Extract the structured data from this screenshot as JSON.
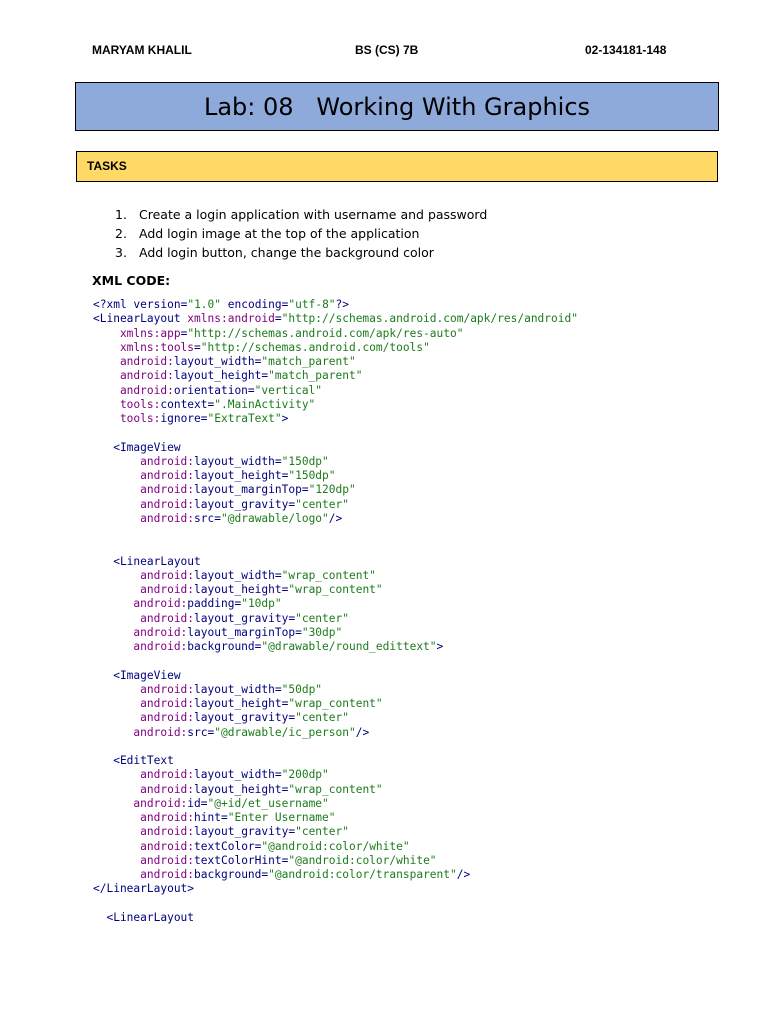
{
  "header": {
    "name": "MARYAM KHALIL",
    "class": "BS (CS) 7B",
    "id": "02-134181-148"
  },
  "title": "Lab: 08   Working With Graphics",
  "tasks_heading": "TASKS",
  "tasks": [
    {
      "num": "1.",
      "text": "Create a login application with username and password"
    },
    {
      "num": "2.",
      "text": "Add login image at the top of the application"
    },
    {
      "num": "3.",
      "text": "Add login button, change the background color"
    }
  ],
  "xml_label": "XML CODE:",
  "code_lines": [
    [
      {
        "t": "<?xml ",
        "k": "tag"
      },
      {
        "t": "version",
        "k": "tag"
      },
      {
        "t": "=",
        "k": "tag"
      },
      {
        "t": "\"1.0\"",
        "k": "val"
      },
      {
        "t": " encoding",
        "k": "tag"
      },
      {
        "t": "=",
        "k": "tag"
      },
      {
        "t": "\"utf-8\"",
        "k": "val"
      },
      {
        "t": "?>",
        "k": "tag"
      }
    ],
    [
      {
        "t": "<LinearLayout ",
        "k": "tag"
      },
      {
        "t": "xmlns:android",
        "k": "attr"
      },
      {
        "t": "=",
        "k": "tag"
      },
      {
        "t": "\"http://schemas.android.com/apk/res/android\"",
        "k": "val"
      }
    ],
    [
      {
        "t": "    xmlns:app",
        "k": "attr"
      },
      {
        "t": "=",
        "k": "tag"
      },
      {
        "t": "\"http://schemas.android.com/apk/res-auto\"",
        "k": "val"
      }
    ],
    [
      {
        "t": "    xmlns:tools",
        "k": "attr"
      },
      {
        "t": "=",
        "k": "tag"
      },
      {
        "t": "\"http://schemas.android.com/tools\"",
        "k": "val"
      }
    ],
    [
      {
        "t": "    android:",
        "k": "attr"
      },
      {
        "t": "layout_width",
        "k": "tag"
      },
      {
        "t": "=",
        "k": "tag"
      },
      {
        "t": "\"match_parent\"",
        "k": "val"
      }
    ],
    [
      {
        "t": "    android:",
        "k": "attr"
      },
      {
        "t": "layout_height",
        "k": "tag"
      },
      {
        "t": "=",
        "k": "tag"
      },
      {
        "t": "\"match_parent\"",
        "k": "val"
      }
    ],
    [
      {
        "t": "    android:",
        "k": "attr"
      },
      {
        "t": "orientation",
        "k": "tag"
      },
      {
        "t": "=",
        "k": "tag"
      },
      {
        "t": "\"vertical\"",
        "k": "val"
      }
    ],
    [
      {
        "t": "    tools:",
        "k": "attr"
      },
      {
        "t": "context",
        "k": "tag"
      },
      {
        "t": "=",
        "k": "tag"
      },
      {
        "t": "\".MainActivity\"",
        "k": "val"
      }
    ],
    [
      {
        "t": "    tools:",
        "k": "attr"
      },
      {
        "t": "ignore",
        "k": "tag"
      },
      {
        "t": "=",
        "k": "tag"
      },
      {
        "t": "\"ExtraText\"",
        "k": "val"
      },
      {
        "t": ">",
        "k": "tag"
      }
    ],
    [],
    [
      {
        "t": "   <ImageView",
        "k": "tag"
      }
    ],
    [
      {
        "t": "       android:",
        "k": "attr"
      },
      {
        "t": "layout_width",
        "k": "tag"
      },
      {
        "t": "=",
        "k": "tag"
      },
      {
        "t": "\"150dp\"",
        "k": "val"
      }
    ],
    [
      {
        "t": "       android:",
        "k": "attr"
      },
      {
        "t": "layout_height",
        "k": "tag"
      },
      {
        "t": "=",
        "k": "tag"
      },
      {
        "t": "\"150dp\"",
        "k": "val"
      }
    ],
    [
      {
        "t": "       android:",
        "k": "attr"
      },
      {
        "t": "layout_marginTop",
        "k": "tag"
      },
      {
        "t": "=",
        "k": "tag"
      },
      {
        "t": "\"120dp\"",
        "k": "val"
      }
    ],
    [
      {
        "t": "       android:",
        "k": "attr"
      },
      {
        "t": "layout_gravity",
        "k": "tag"
      },
      {
        "t": "=",
        "k": "tag"
      },
      {
        "t": "\"center\"",
        "k": "val"
      }
    ],
    [
      {
        "t": "       android:",
        "k": "attr"
      },
      {
        "t": "src",
        "k": "tag"
      },
      {
        "t": "=",
        "k": "tag"
      },
      {
        "t": "\"@drawable/logo\"",
        "k": "val"
      },
      {
        "t": "/>",
        "k": "tag"
      }
    ],
    [],
    [],
    [
      {
        "t": "   <LinearLayout",
        "k": "tag"
      }
    ],
    [
      {
        "t": "       android:",
        "k": "attr"
      },
      {
        "t": "layout_width",
        "k": "tag"
      },
      {
        "t": "=",
        "k": "tag"
      },
      {
        "t": "\"wrap_content\"",
        "k": "val"
      }
    ],
    [
      {
        "t": "       android:",
        "k": "attr"
      },
      {
        "t": "layout_height",
        "k": "tag"
      },
      {
        "t": "=",
        "k": "tag"
      },
      {
        "t": "\"wrap_content\"",
        "k": "val"
      }
    ],
    [
      {
        "t": "      android:",
        "k": "attr"
      },
      {
        "t": "padding",
        "k": "tag"
      },
      {
        "t": "=",
        "k": "tag"
      },
      {
        "t": "\"10dp\"",
        "k": "val"
      }
    ],
    [
      {
        "t": "       android:",
        "k": "attr"
      },
      {
        "t": "layout_gravity",
        "k": "tag"
      },
      {
        "t": "=",
        "k": "tag"
      },
      {
        "t": "\"center\"",
        "k": "val"
      }
    ],
    [
      {
        "t": "      android:",
        "k": "attr"
      },
      {
        "t": "layout_marginTop",
        "k": "tag"
      },
      {
        "t": "=",
        "k": "tag"
      },
      {
        "t": "\"30dp\"",
        "k": "val"
      }
    ],
    [
      {
        "t": "      android:",
        "k": "attr"
      },
      {
        "t": "background",
        "k": "tag"
      },
      {
        "t": "=",
        "k": "tag"
      },
      {
        "t": "\"@drawable/round_edittext\"",
        "k": "val"
      },
      {
        "t": ">",
        "k": "tag"
      }
    ],
    [],
    [
      {
        "t": "   <ImageView",
        "k": "tag"
      }
    ],
    [
      {
        "t": "       android:",
        "k": "attr"
      },
      {
        "t": "layout_width",
        "k": "tag"
      },
      {
        "t": "=",
        "k": "tag"
      },
      {
        "t": "\"50dp\"",
        "k": "val"
      }
    ],
    [
      {
        "t": "       android:",
        "k": "attr"
      },
      {
        "t": "layout_height",
        "k": "tag"
      },
      {
        "t": "=",
        "k": "tag"
      },
      {
        "t": "\"wrap_content\"",
        "k": "val"
      }
    ],
    [
      {
        "t": "       android:",
        "k": "attr"
      },
      {
        "t": "layout_gravity",
        "k": "tag"
      },
      {
        "t": "=",
        "k": "tag"
      },
      {
        "t": "\"center\"",
        "k": "val"
      }
    ],
    [
      {
        "t": "      android:",
        "k": "attr"
      },
      {
        "t": "src",
        "k": "tag"
      },
      {
        "t": "=",
        "k": "tag"
      },
      {
        "t": "\"@drawable/ic_person\"",
        "k": "val"
      },
      {
        "t": "/>",
        "k": "tag"
      }
    ],
    [],
    [
      {
        "t": "   <EditText",
        "k": "tag"
      }
    ],
    [
      {
        "t": "       android:",
        "k": "attr"
      },
      {
        "t": "layout_width",
        "k": "tag"
      },
      {
        "t": "=",
        "k": "tag"
      },
      {
        "t": "\"200dp\"",
        "k": "val"
      }
    ],
    [
      {
        "t": "       android:",
        "k": "attr"
      },
      {
        "t": "layout_height",
        "k": "tag"
      },
      {
        "t": "=",
        "k": "tag"
      },
      {
        "t": "\"wrap_content\"",
        "k": "val"
      }
    ],
    [
      {
        "t": "      android:",
        "k": "attr"
      },
      {
        "t": "id",
        "k": "tag"
      },
      {
        "t": "=",
        "k": "tag"
      },
      {
        "t": "\"@+id/et_username\"",
        "k": "val"
      }
    ],
    [
      {
        "t": "       android:",
        "k": "attr"
      },
      {
        "t": "hint",
        "k": "tag"
      },
      {
        "t": "=",
        "k": "tag"
      },
      {
        "t": "\"Enter Username\"",
        "k": "val"
      }
    ],
    [
      {
        "t": "       android:",
        "k": "attr"
      },
      {
        "t": "layout_gravity",
        "k": "tag"
      },
      {
        "t": "=",
        "k": "tag"
      },
      {
        "t": "\"center\"",
        "k": "val"
      }
    ],
    [
      {
        "t": "       android:",
        "k": "attr"
      },
      {
        "t": "textColor",
        "k": "tag"
      },
      {
        "t": "=",
        "k": "tag"
      },
      {
        "t": "\"@android:color/white\"",
        "k": "val"
      }
    ],
    [
      {
        "t": "       android:",
        "k": "attr"
      },
      {
        "t": "textColorHint",
        "k": "tag"
      },
      {
        "t": "=",
        "k": "tag"
      },
      {
        "t": "\"@android:color/white\"",
        "k": "val"
      }
    ],
    [
      {
        "t": "       android:",
        "k": "attr"
      },
      {
        "t": "background",
        "k": "tag"
      },
      {
        "t": "=",
        "k": "tag"
      },
      {
        "t": "\"@android:color/transparent\"",
        "k": "val"
      },
      {
        "t": "/>",
        "k": "tag"
      }
    ],
    [
      {
        "t": "</LinearLayout>",
        "k": "tag"
      }
    ],
    [],
    [
      {
        "t": "  <LinearLayout",
        "k": "tag"
      }
    ]
  ],
  "colors": {
    "title_bg": "#8eaadb",
    "tasks_bg": "#ffd966",
    "tag": "#00007f",
    "attr": "#7f007f",
    "value": "#1c7c1c"
  }
}
